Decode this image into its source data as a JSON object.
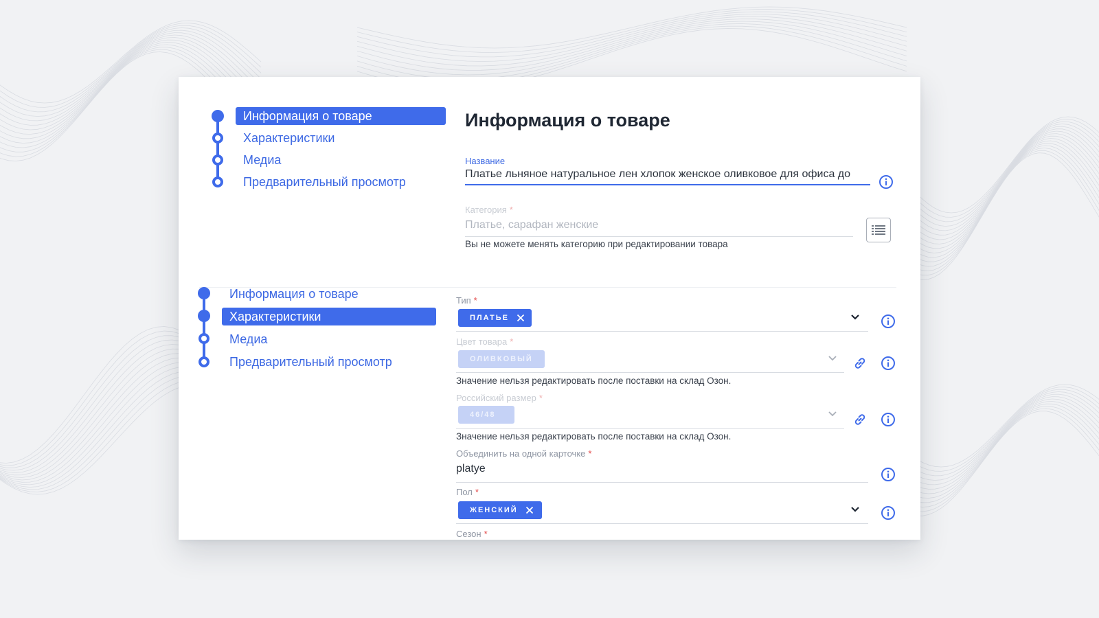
{
  "steps_top": {
    "items": [
      {
        "label": "Информация о товаре",
        "state": "active"
      },
      {
        "label": "Характеристики",
        "state": "pending"
      },
      {
        "label": "Медиа",
        "state": "pending"
      },
      {
        "label": "Предварительный просмотр",
        "state": "pending"
      }
    ]
  },
  "steps_bottom": {
    "items": [
      {
        "label": "Информация о товаре",
        "state": "done"
      },
      {
        "label": "Характеристики",
        "state": "active"
      },
      {
        "label": "Медиа",
        "state": "pending"
      },
      {
        "label": "Предварительный просмотр",
        "state": "pending"
      }
    ]
  },
  "product_info": {
    "title": "Информация о товаре",
    "name": {
      "label": "Название",
      "value": "Платье льняное натуральное лен хлопок женское оливковое для офиса до"
    },
    "category": {
      "label": "Категория",
      "value": "Платье, сарафан женские",
      "hint": "Вы не можете менять категорию при редактировании товара",
      "button_icon": "list-icon"
    }
  },
  "characteristics": {
    "type": {
      "label": "Тип",
      "chip": "ПЛАТЬЕ",
      "editable": true
    },
    "color": {
      "label": "Цвет товара",
      "chip": "ОЛИВКОВЫЙ",
      "editable": false,
      "hint": "Значение нельзя редактировать после поставки на склад Озон."
    },
    "size": {
      "label": "Российский размер",
      "chip": "46/48",
      "editable": false,
      "hint": "Значение нельзя редактировать после поставки на склад Озон."
    },
    "merge": {
      "label": "Объединить на одной карточке",
      "value": "platye"
    },
    "gender": {
      "label": "Пол",
      "chip": "ЖЕНСКИЙ",
      "editable": true
    },
    "season": {
      "label": "Сезон"
    }
  },
  "required_mark": "*",
  "colors": {
    "accent": "#3f6bea",
    "required": "#e34a4a",
    "background": "#f1f2f4"
  }
}
